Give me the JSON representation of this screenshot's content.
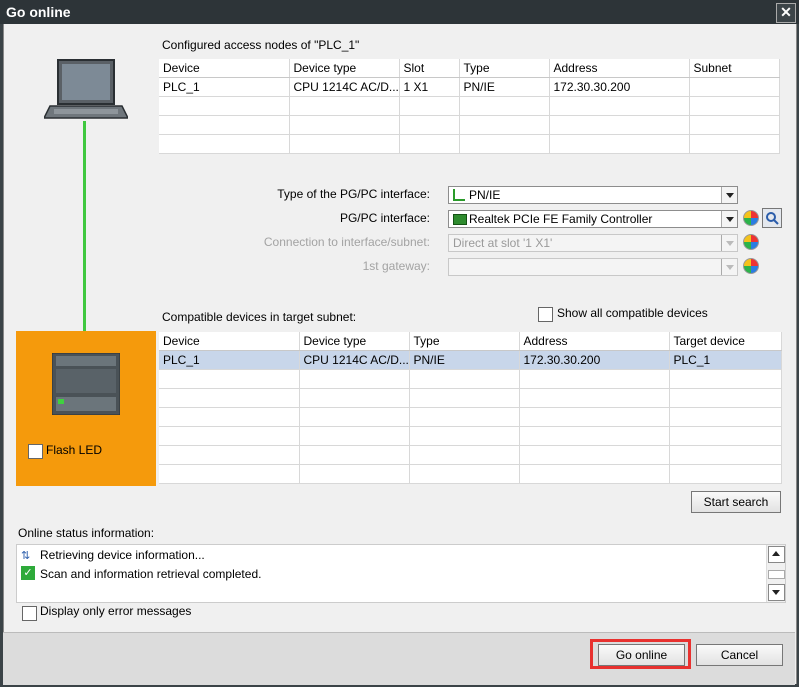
{
  "window": {
    "title": "Go online",
    "close_glyph": "✕"
  },
  "configured": {
    "heading": "Configured access nodes of \"PLC_1\"",
    "columns": [
      "Device",
      "Device type",
      "Slot",
      "Type",
      "Address",
      "Subnet"
    ],
    "rows": [
      [
        "PLC_1",
        "CPU 1214C AC/D...",
        "1 X1",
        "PN/IE",
        "172.30.30.200",
        ""
      ]
    ]
  },
  "interface": {
    "type_label": "Type of the PG/PC interface:",
    "type_value": "PN/IE",
    "pgpc_label": "PG/PC interface:",
    "pgpc_value": "Realtek PCIe FE Family Controller",
    "connection_label": "Connection to interface/subnet:",
    "connection_value": "Direct at slot '1 X1'",
    "gateway_label": "1st gateway:",
    "gateway_value": ""
  },
  "compatible": {
    "heading": "Compatible devices in target subnet:",
    "show_all_label": "Show all compatible devices",
    "show_all_checked": false,
    "columns": [
      "Device",
      "Device type",
      "Type",
      "Address",
      "Target device"
    ],
    "rows": [
      [
        "PLC_1",
        "CPU 1214C AC/D...",
        "PN/IE",
        "172.30.30.200",
        "PLC_1"
      ]
    ]
  },
  "flash_led": {
    "label": "Flash LED",
    "checked": false
  },
  "start_search_label": "Start search",
  "status": {
    "heading": "Online status information:",
    "messages": [
      {
        "icon": "busy-icon",
        "text": "Retrieving device information..."
      },
      {
        "icon": "check-icon",
        "text": "Scan and information retrieval completed."
      }
    ],
    "error_only_label": "Display only error messages",
    "error_only_checked": false
  },
  "buttons": {
    "go_online": "Go online",
    "cancel": "Cancel"
  },
  "colors": {
    "link_line": "#3fc83f",
    "device_panel": "#f59a0c",
    "highlight_box": "#e8312f",
    "selected_row": "#c8d6ea"
  }
}
